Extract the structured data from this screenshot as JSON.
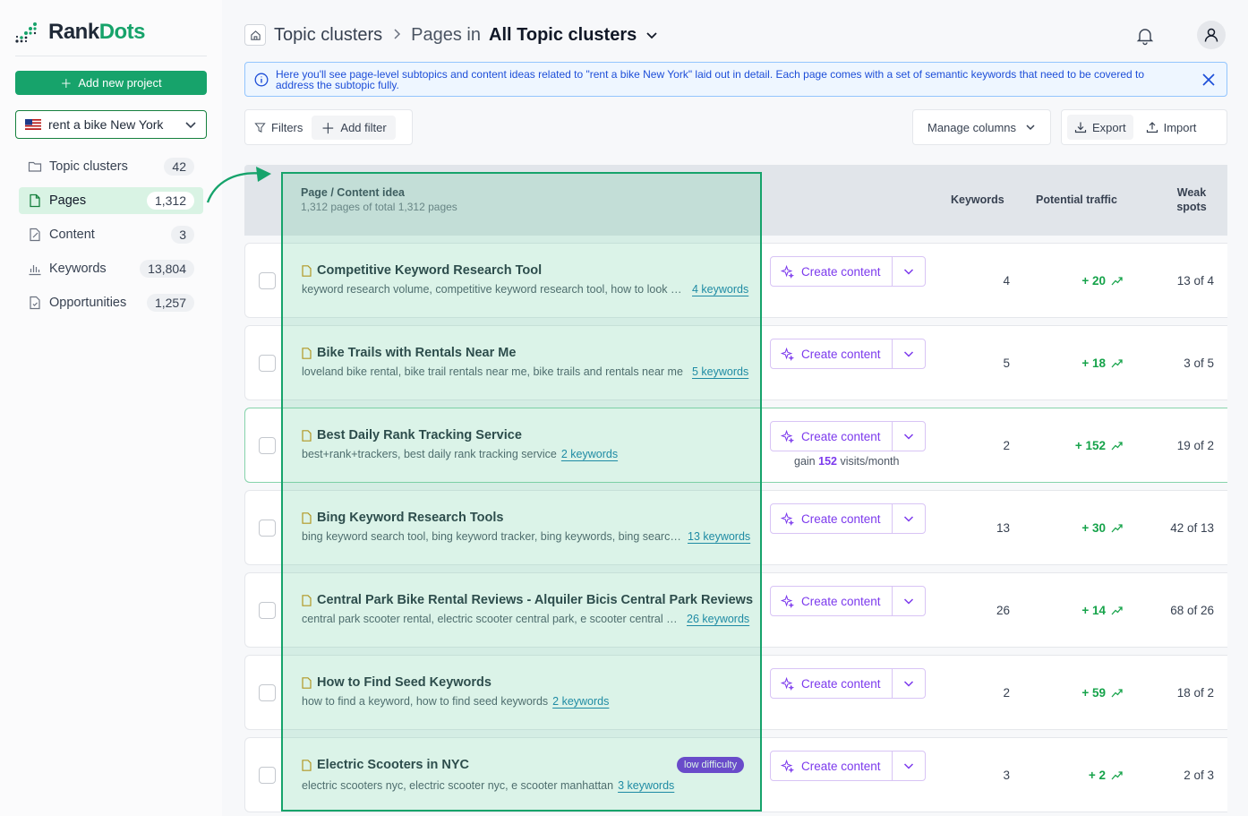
{
  "app": {
    "brand_a": "Rank",
    "brand_b": "Dots",
    "brand_color": "#16a36a"
  },
  "sidebar": {
    "add_project": "Add new project",
    "project": "rent a bike New York",
    "items": [
      {
        "label": "Topic clusters",
        "count": "42",
        "icon": "folder-icon"
      },
      {
        "label": "Pages",
        "count": "1,312",
        "icon": "page-icon"
      },
      {
        "label": "Content",
        "count": "3",
        "icon": "content-icon"
      },
      {
        "label": "Keywords",
        "count": "13,804",
        "icon": "bar-chart-icon"
      },
      {
        "label": "Opportunities",
        "count": "1,257",
        "icon": "opportunity-icon"
      }
    ]
  },
  "header": {
    "crumb1": "Topic clusters",
    "crumb2": "Pages in",
    "crumb3": "All Topic clusters"
  },
  "info": {
    "text": "Here you'll see page-level subtopics and content ideas related to \"rent a bike New York\" laid out in detail. Each page comes with a set of semantic keywords that need to be covered to address the subtopic fully."
  },
  "toolbar": {
    "filters": "Filters",
    "add_filter": "Add filter",
    "manage_columns": "Manage columns",
    "export": "Export",
    "import": "Import"
  },
  "table": {
    "col_page": "Page / Content idea",
    "col_page_sub": "1,312 pages of total 1,312 pages",
    "col_keywords": "Keywords",
    "col_traffic": "Potential traffic",
    "col_weak_1": "Weak",
    "col_weak_2": "spots",
    "create_label": "Create content",
    "rows": [
      {
        "title": "Competitive Keyword Research Tool",
        "kws": "keyword research volume, competitive keyword research tool, how to look up search volume on google",
        "kw_link": "4 keywords",
        "keywords": "4",
        "traffic": "+ 20",
        "weak": "13 of 4"
      },
      {
        "title": "Bike Trails with Rentals Near Me",
        "kws": "loveland bike rental, bike trail rentals near me, bike trails and rentals near me",
        "kw_link": "5 keywords",
        "keywords": "5",
        "traffic": "+ 18",
        "weak": "3 of 5"
      },
      {
        "title": "Best Daily Rank Tracking Service",
        "kws": "best+rank+trackers, best daily rank tracking service",
        "kw_link": "2 keywords",
        "keywords": "2",
        "traffic": "+ 152",
        "weak": "19 of 2",
        "gain_a": "gain",
        "gain_b": "152",
        "gain_c": "visits/month"
      },
      {
        "title": "Bing Keyword Research Tools",
        "kws": "bing keyword search tool, bing keyword tracker, bing keywords, bing search volume",
        "kw_link": "13 keywords",
        "keywords": "13",
        "traffic": "+ 30",
        "weak": "42 of 13"
      },
      {
        "title": "Central Park Bike Rental Reviews - Alquiler Bicis Central Park Reviews",
        "kws": "central park scooter rental, electric scooter central park, e scooter central park rental",
        "kw_link": "26 keywords",
        "keywords": "26",
        "traffic": "+ 14",
        "weak": "68 of 26"
      },
      {
        "title": "How to Find Seed Keywords",
        "kws": "how to find a keyword, how to find seed keywords",
        "kw_link": "2 keywords",
        "keywords": "2",
        "traffic": "+ 59",
        "weak": "18 of 2"
      },
      {
        "title": "Electric Scooters in NYC",
        "kws": "electric scooters nyc, electric scooter nyc, e scooter manhattan",
        "kw_link": "3 keywords",
        "keywords": "3",
        "traffic": "+ 2",
        "weak": "2 of 3",
        "badge": "low difficulty"
      }
    ]
  }
}
